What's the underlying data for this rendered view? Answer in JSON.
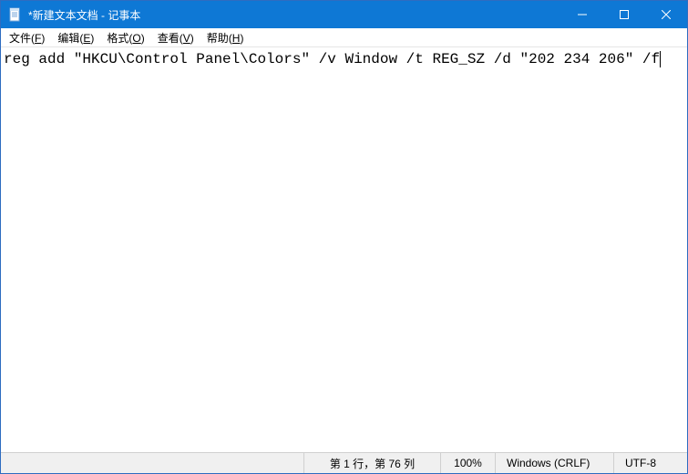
{
  "titlebar": {
    "icon_name": "notepad-icon",
    "title": "*新建文本文档 - 记事本",
    "minimize_label": "minimize",
    "maximize_label": "maximize",
    "close_label": "close"
  },
  "menu": {
    "file": {
      "label": "文件",
      "accel": "F"
    },
    "edit": {
      "label": "编辑",
      "accel": "E"
    },
    "format": {
      "label": "格式",
      "accel": "O"
    },
    "view": {
      "label": "查看",
      "accel": "V"
    },
    "help": {
      "label": "帮助",
      "accel": "H"
    }
  },
  "editor": {
    "content": "reg add \"HKCU\\Control Panel\\Colors\" /v Window /t REG_SZ /d \"202 234 206\" /f"
  },
  "status": {
    "position": "第 1 行，第 76 列",
    "zoom": "100%",
    "line_ending": "Windows (CRLF)",
    "encoding": "UTF-8"
  },
  "colors": {
    "titlebar": "#0e78d5"
  }
}
